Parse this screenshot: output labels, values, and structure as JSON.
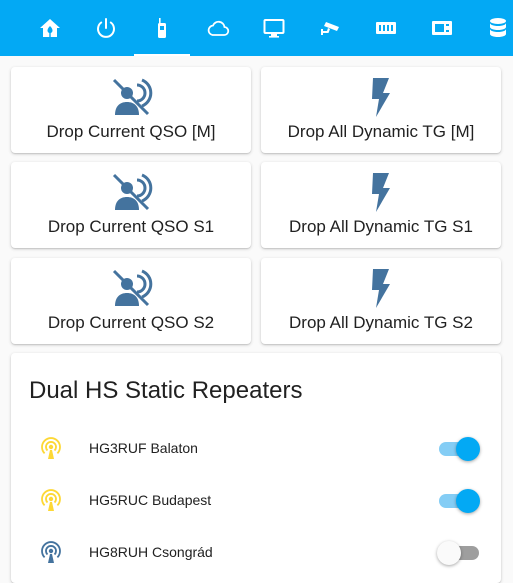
{
  "colors": {
    "accent": "#03a9f4",
    "icon_blue": "#44739e",
    "icon_active_yellow": "#fdd835",
    "icon_inactive": "#44739e"
  },
  "tabs": [
    {
      "icon": "home-icon"
    },
    {
      "icon": "power-icon"
    },
    {
      "icon": "radio-icon",
      "active": true
    },
    {
      "icon": "cloud-icon"
    },
    {
      "icon": "monitor-icon"
    },
    {
      "icon": "cctv-icon"
    },
    {
      "icon": "memory-icon"
    },
    {
      "icon": "chip-icon"
    },
    {
      "icon": "database-icon"
    }
  ],
  "buttons": [
    {
      "label": "Drop Current QSO [M]",
      "icon": "voice-off-icon"
    },
    {
      "label": "Drop All Dynamic TG [M]",
      "icon": "flash-icon"
    },
    {
      "label": "Drop Current QSO S1",
      "icon": "voice-off-icon"
    },
    {
      "label": "Drop All Dynamic TG S1",
      "icon": "flash-icon"
    },
    {
      "label": "Drop Current QSO S2",
      "icon": "voice-off-icon"
    },
    {
      "label": "Drop All Dynamic TG S2",
      "icon": "flash-icon"
    }
  ],
  "repeaters": {
    "title": "Dual HS Static Repeaters",
    "items": [
      {
        "label": "HG3RUF Balaton",
        "icon": "radio-tower-icon",
        "on": true
      },
      {
        "label": "HG5RUC Budapest",
        "icon": "radio-tower-icon",
        "on": true
      },
      {
        "label": "HG8RUH Csongrád",
        "icon": "radio-tower-icon",
        "on": false
      }
    ]
  }
}
